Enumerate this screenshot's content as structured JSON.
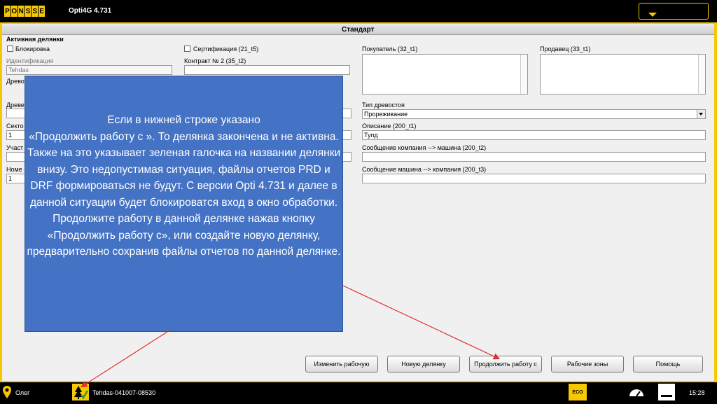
{
  "topbar": {
    "logo_letters": [
      "P",
      "O",
      "N",
      "S",
      "S",
      "E"
    ],
    "app_title": "Opti4G 4.731",
    "accent": "#f6c800"
  },
  "header": {
    "title": "Стандарт"
  },
  "form": {
    "section_title": "Активная делянки",
    "lock_label": "Блокировка",
    "certification_label": "Сертификация (21_t5)",
    "identification_label": "Идентификация",
    "identification_value": "Tehdas",
    "contract_label": "Контракт № 2 (35_t2)",
    "contract_value": "",
    "wood_label_1": "Древо",
    "wood_label_2": "Древе",
    "sector_label": "Секто",
    "sector_value": "1",
    "plot_label": "Участ",
    "plot_value": "",
    "number_label": "Номе",
    "number_value": "1",
    "buyer_label": "Покупатель (32_t1)",
    "seller_label": "Продавец (33_t1)",
    "stand_type_label": "Тип древостоя",
    "stand_type_value": "Прореживание",
    "description_label": "Описание (200_t1)",
    "description_value": "Тупд",
    "msg_company_to_machine_label": "Сообщение компания --> машина (200_t2)",
    "msg_machine_to_company_label": "Сообщение машина --> компания (200_t3)"
  },
  "buttons": {
    "change_work": "Изменить рабочую",
    "new_plot": "Новую делянку",
    "continue_work": "Продолжить работу с",
    "work_zones": "Рабочие зоны",
    "help": "Помощь"
  },
  "overlay": {
    "color": "#4472c4",
    "text": "Если в нижней строке указано\n«Продолжить работу с ».  То делянка закончена и не активна. Также на это указывает зеленая галочка на названии делянки внизу. Это недопустимая ситуация, файлы отчетов PRD и DRF формироваться не будут. С версии Opti 4.731 и далее в данной ситуации будет блокироватся вход в окно обработки. Продолжите работу в данной делянке нажав кнопку «Продолжить работу с», или  создайте новую делянку, предварительно сохранив файлы отчетов по данной делянке."
  },
  "statusbar": {
    "user": "Олег",
    "file": "Tehdas-041007-08530",
    "eco": "ECO",
    "time": "15:28"
  },
  "icons": {
    "pin": "pin-icon",
    "tree": "tree-check-icon",
    "gauge": "gauge-icon",
    "bar": "screen-icon"
  }
}
